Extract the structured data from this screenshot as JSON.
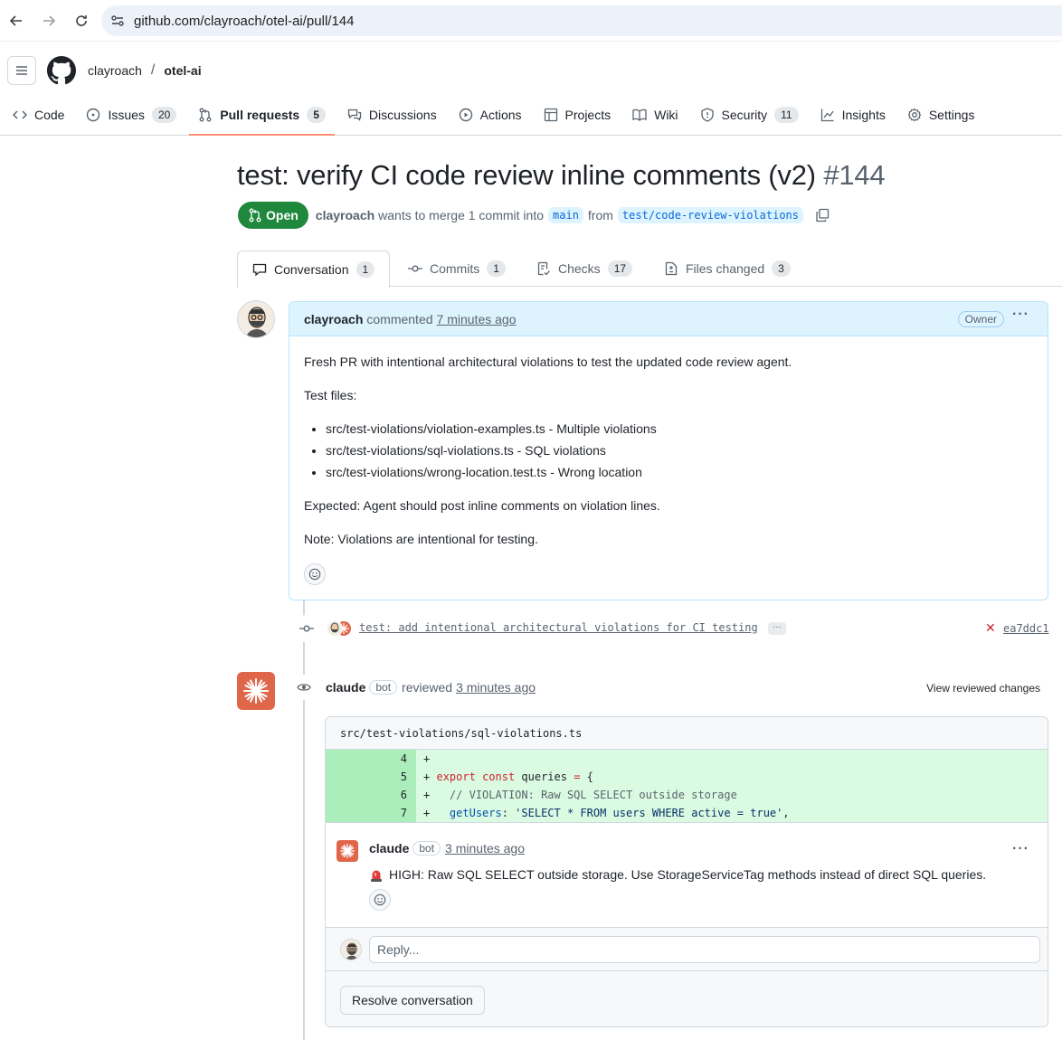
{
  "browser": {
    "url": "github.com/clayroach/otel-ai/pull/144"
  },
  "repo": {
    "owner": "clayroach",
    "name": "otel-ai",
    "nav": [
      {
        "label": "Code",
        "icon": "code-icon",
        "count": ""
      },
      {
        "label": "Issues",
        "icon": "issue-icon",
        "count": "20"
      },
      {
        "label": "Pull requests",
        "icon": "pull-request-icon",
        "count": "5"
      },
      {
        "label": "Discussions",
        "icon": "discussions-icon",
        "count": ""
      },
      {
        "label": "Actions",
        "icon": "play-icon",
        "count": ""
      },
      {
        "label": "Projects",
        "icon": "table-icon",
        "count": ""
      },
      {
        "label": "Wiki",
        "icon": "book-icon",
        "count": ""
      },
      {
        "label": "Security",
        "icon": "shield-icon",
        "count": "11"
      },
      {
        "label": "Insights",
        "icon": "graph-icon",
        "count": ""
      },
      {
        "label": "Settings",
        "icon": "gear-icon",
        "count": ""
      }
    ]
  },
  "pr": {
    "title": "test: verify CI code review inline comments (v2)",
    "number": "#144",
    "state": "Open",
    "author": "clayroach",
    "merge_text": "wants to merge 1 commit into",
    "base_branch": "main",
    "from_text": "from",
    "head_branch": "test/code-review-violations"
  },
  "pr_tabs": [
    {
      "label": "Conversation",
      "count": "1",
      "icon": "comment-icon"
    },
    {
      "label": "Commits",
      "count": "1",
      "icon": "commit-icon"
    },
    {
      "label": "Checks",
      "count": "17",
      "icon": "checklist-icon"
    },
    {
      "label": "Files changed",
      "count": "3",
      "icon": "file-diff-icon"
    }
  ],
  "comment": {
    "author": "clayroach",
    "action": "commented",
    "time": "7 minutes ago",
    "role_badge": "Owner",
    "p1": "Fresh PR with intentional architectural violations to test the updated code review agent.",
    "p2": "Test files:",
    "files": [
      "src/test-violations/violation-examples.ts - Multiple violations",
      "src/test-violations/sql-violations.ts - SQL violations",
      "src/test-violations/wrong-location.test.ts - Wrong location"
    ],
    "p3": "Expected: Agent should post inline comments on violation lines.",
    "p4": "Note: Violations are intentional for testing."
  },
  "commit": {
    "message": "test: add intentional architectural violations for CI testing",
    "more": "…",
    "status": "✕",
    "sha": "ea7ddc1"
  },
  "review": {
    "author": "claude",
    "bot_badge": "bot",
    "action": "reviewed",
    "time": "3 minutes ago",
    "view_changes": "View reviewed changes",
    "file": "src/test-violations/sql-violations.ts",
    "diff_lines": [
      {
        "num": "4",
        "prefix": "+",
        "code": ""
      },
      {
        "num": "5",
        "prefix": "+",
        "code": "export const queries = {"
      },
      {
        "num": "6",
        "prefix": "+",
        "code": "  // VIOLATION: Raw SQL SELECT outside storage"
      },
      {
        "num": "7",
        "prefix": "+",
        "code": "  getUsers: 'SELECT * FROM users WHERE active = true',"
      }
    ],
    "inline": {
      "author": "claude",
      "bot_badge": "bot",
      "time": "3 minutes ago",
      "body": "HIGH: Raw SQL SELECT outside storage. Use StorageServiceTag methods instead of direct SQL queries."
    },
    "reply_placeholder": "Reply...",
    "resolve_label": "Resolve conversation"
  },
  "colors": {
    "open_green": "#1f883d",
    "link_blue": "#0969da",
    "claude_orange": "#e0664a",
    "diff_add": "#dafbe1",
    "diff_num_add": "#aceebb"
  }
}
